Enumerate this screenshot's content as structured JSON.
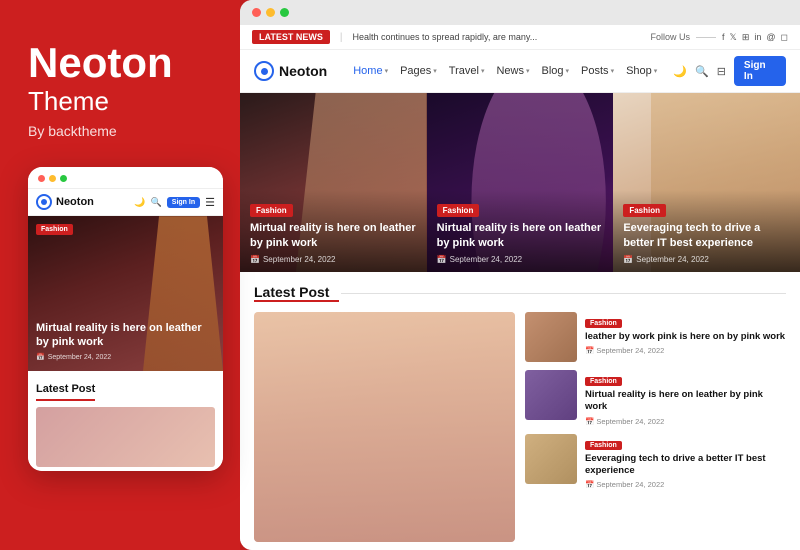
{
  "left": {
    "brand_title": "Neoton",
    "brand_subtitle": "Theme",
    "brand_by": "By backtheme",
    "mobile": {
      "logo_text": "Neoton",
      "sign_btn": "Sign In",
      "hero": {
        "badge": "Fashion",
        "title": "Mirtual reality is here on leather by pink work",
        "date": "September 24, 2022"
      },
      "latest_title": "Latest Post"
    }
  },
  "browser": {
    "ticker": {
      "label": "LATEST NEWS",
      "text": "Health continues to spread rapidly, are many...",
      "follow": "Follow Us"
    },
    "nav": {
      "logo": "Neoton",
      "links": [
        "Home",
        "Pages",
        "Travel",
        "News",
        "Blog",
        "Posts",
        "Shop"
      ],
      "sign_btn": "Sign In"
    },
    "hero_cards": [
      {
        "badge": "Fashion",
        "title": "Mirtual reality is here on leather by pink work",
        "date": "September 24, 2022"
      },
      {
        "badge": "Fashion",
        "title": "Nirtual reality is here on leather by pink work",
        "date": "September 24, 2022"
      },
      {
        "badge": "Fashion",
        "title": "Eeveraging tech to drive a better IT best experience",
        "date": "September 24, 2022"
      }
    ],
    "latest": {
      "title": "Latest Post",
      "mini_posts": [
        {
          "badge": "Fashion",
          "title": "leather by work pink is here on by pink work",
          "date": "September 24, 2022"
        },
        {
          "badge": "Fashion",
          "title": "Nirtual reality is here on leather by pink work",
          "date": "September 24, 2022"
        },
        {
          "badge": "Fashion",
          "title": "Eeveraging tech to drive a better IT best experience",
          "date": "September 24, 2022"
        }
      ]
    }
  }
}
